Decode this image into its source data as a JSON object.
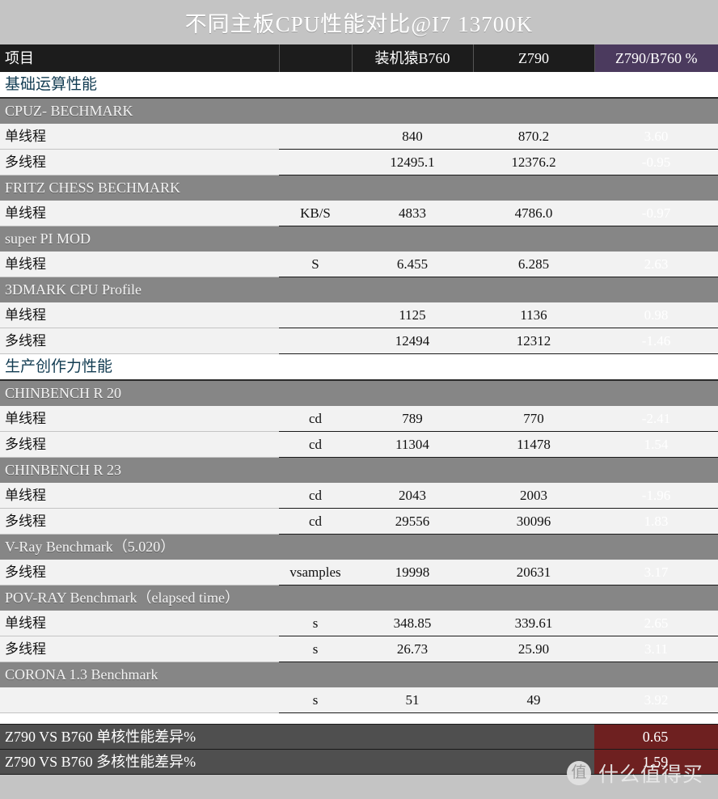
{
  "title": "不同主板CPU性能对比@I7 13700K",
  "header": {
    "item_label": "项目",
    "blank_label": "",
    "col_b760": "装机猿B760",
    "col_z790": "Z790",
    "col_pct": "Z790/B760 %"
  },
  "colors": {
    "title_bg": "#c4c4c4",
    "header_bg": "#1c1c1c",
    "header_pct_bg": "#4b3a5e",
    "group_text": "#123c52",
    "subsection_bg": "#868686",
    "data_bg": "#f2f2f2",
    "pct_green": "#769934",
    "pct_blue": "#2f6498",
    "pct_red": "#6e2020",
    "summary_bg": "#4f4f4f"
  },
  "rows": [
    {
      "kind": "group",
      "label": "基础运算性能"
    },
    {
      "kind": "sub",
      "label": "CPUZ- BECHMARK"
    },
    {
      "kind": "data",
      "item": "单线程",
      "unit": "",
      "b760": "840",
      "z790": "870.2",
      "pct": "3.60",
      "pct_color": "green",
      "ruled": false
    },
    {
      "kind": "data",
      "item": "多线程",
      "unit": "",
      "b760": "12495.1",
      "z790": "12376.2",
      "pct": "-0.95",
      "pct_color": "green",
      "ruled": false
    },
    {
      "kind": "sub",
      "label": "FRITZ CHESS BECHMARK"
    },
    {
      "kind": "data",
      "item": "单线程",
      "unit": "KB/S",
      "b760": "4833",
      "z790": "4786.0",
      "pct": "-0.97",
      "pct_color": "green",
      "ruled": false
    },
    {
      "kind": "sub",
      "label": "super PI MOD"
    },
    {
      "kind": "data",
      "item": "单线程",
      "unit": "S",
      "b760": "6.455",
      "z790": "6.285",
      "pct": "2.63",
      "pct_color": "green",
      "ruled": false
    },
    {
      "kind": "sub",
      "label": "3DMARK CPU Profile"
    },
    {
      "kind": "data",
      "item": "单线程",
      "unit": "",
      "b760": "1125",
      "z790": "1136",
      "pct": "0.98",
      "pct_color": "green",
      "ruled": false
    },
    {
      "kind": "data",
      "item": "多线程",
      "unit": "",
      "b760": "12494",
      "z790": "12312",
      "pct": "-1.46",
      "pct_color": "green",
      "ruled": false
    },
    {
      "kind": "group",
      "label": "生产创作力性能"
    },
    {
      "kind": "sub",
      "label": "CHINBENCH R 20"
    },
    {
      "kind": "data",
      "item": "单线程",
      "unit": "cd",
      "b760": "789",
      "z790": "770",
      "pct": "-2.41",
      "pct_color": "blue",
      "ruled": false
    },
    {
      "kind": "data",
      "item": "多线程",
      "unit": "cd",
      "b760": "11304",
      "z790": "11478",
      "pct": "1.54",
      "pct_color": "blue",
      "ruled": false
    },
    {
      "kind": "sub",
      "label": "CHINBENCH R 23"
    },
    {
      "kind": "data",
      "item": "单线程",
      "unit": "cd",
      "b760": "2043",
      "z790": "2003",
      "pct": "-1.96",
      "pct_color": "blue",
      "ruled": false
    },
    {
      "kind": "data",
      "item": "多线程",
      "unit": "cd",
      "b760": "29556",
      "z790": "30096",
      "pct": "1.83",
      "pct_color": "blue",
      "ruled": false
    },
    {
      "kind": "sub",
      "label": "V-Ray Benchmark（5.020）"
    },
    {
      "kind": "data",
      "item": "多线程",
      "unit": "vsamples",
      "b760": "19998",
      "z790": "20631",
      "pct": "3.17",
      "pct_color": "blue",
      "ruled": false
    },
    {
      "kind": "sub",
      "label": "POV-RAY Benchmark（elapsed time）"
    },
    {
      "kind": "data",
      "item": "单线程",
      "unit": "s",
      "b760": "348.85",
      "z790": "339.61",
      "pct": "2.65",
      "pct_color": "blue",
      "ruled": false
    },
    {
      "kind": "data",
      "item": "多线程",
      "unit": "s",
      "b760": "26.73",
      "z790": "25.90",
      "pct": "3.11",
      "pct_color": "blue",
      "ruled": false
    },
    {
      "kind": "sub",
      "label": "CORONA 1.3 Benchmark"
    },
    {
      "kind": "data",
      "item": "",
      "unit": "s",
      "b760": "51",
      "z790": "49",
      "pct": "3.92",
      "pct_color": "blue",
      "ruled": false
    },
    {
      "kind": "spacer-white"
    },
    {
      "kind": "summary",
      "label": "Z790 VS B760 单核性能差异%",
      "pct": "0.65"
    },
    {
      "kind": "summary",
      "label": "Z790 VS B760 多核性能差异%",
      "pct": "1.59"
    },
    {
      "kind": "spacer-gray"
    }
  ],
  "watermark": {
    "badge": "值",
    "text": "什么值得买"
  }
}
